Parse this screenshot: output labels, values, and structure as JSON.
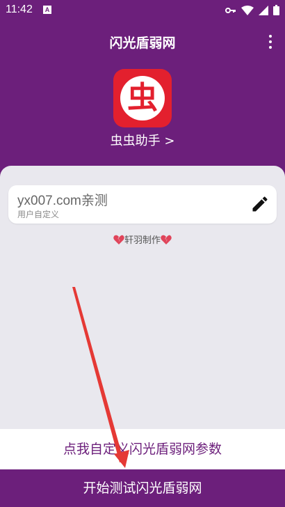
{
  "status_bar": {
    "time": "11:42",
    "notification_letter": "A",
    "icons": [
      "key-icon",
      "wifi-icon",
      "signal-icon",
      "battery-icon"
    ]
  },
  "app_bar": {
    "title": "闪光盾弱网",
    "menu_icon": "more-vert-icon"
  },
  "app_link": {
    "logo_char": "虫",
    "label": "虫虫助手 >"
  },
  "config_card": {
    "value": "yx007.com亲测",
    "subtitle": "用户自定义",
    "edit_icon": "pencil-icon"
  },
  "credit": {
    "text": "轩羽制作",
    "icon": "broken-heart-icon"
  },
  "buttons": {
    "customize": "点我自定义闪光盾弱网参数",
    "start": "开始测试闪光盾弱网"
  },
  "colors": {
    "primary": "#6c1f7b",
    "logo_red": "#e3202e",
    "background": "#e9e8ee",
    "annotation_arrow": "#e53935"
  }
}
